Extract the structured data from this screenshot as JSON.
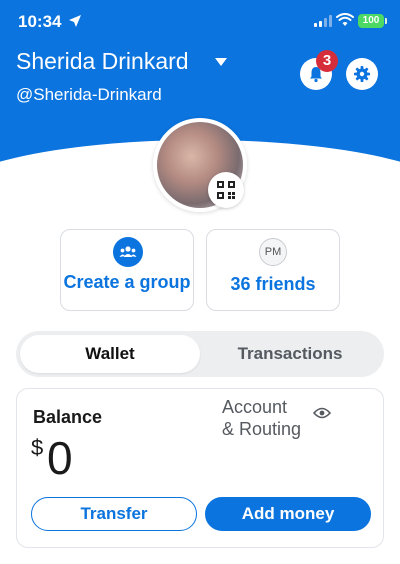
{
  "status_bar": {
    "time": "10:34",
    "battery": "100"
  },
  "profile": {
    "name": "Sherida Drinkard",
    "handle": "@Sherida-Drinkard",
    "notification_count": "3"
  },
  "tiles": {
    "create_group_label": "Create a group",
    "friends_initials": "PM",
    "friends_label": "36 friends"
  },
  "tabs": {
    "wallet": "Wallet",
    "transactions": "Transactions"
  },
  "balance": {
    "label": "Balance",
    "currency_symbol": "$",
    "amount": "0",
    "account_routing_line1": "Account",
    "account_routing_line2": "& Routing",
    "transfer_label": "Transfer",
    "add_money_label": "Add money"
  },
  "colors": {
    "accent": "#0b74de",
    "badge": "#d62d3a",
    "battery": "#4cd964"
  }
}
